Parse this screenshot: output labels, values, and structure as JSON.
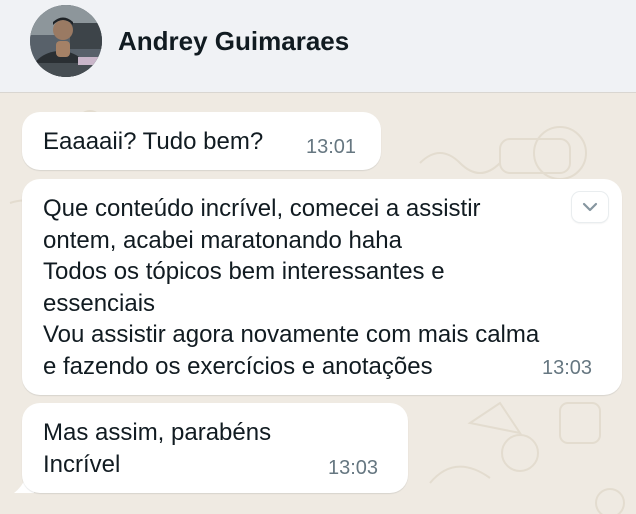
{
  "header": {
    "contact_name": "Andrey Guimaraes"
  },
  "messages": [
    {
      "text": "Eaaaaii? Tudo bem?",
      "time": "13:01"
    },
    {
      "text": "Que conteúdo incrível, comecei a assistir\nontem, acabei maratonando haha\nTodos os tópicos bem interessantes e\nessenciais\nVou assistir agora novamente com mais calma\ne fazendo os exercícios e anotações",
      "time": "13:03"
    },
    {
      "text": "Mas assim, parabéns\nIncrível",
      "time": "13:03"
    }
  ],
  "icons": {
    "message_menu": "chevron-down-icon"
  },
  "colors": {
    "header_bg": "#f0f2f5",
    "chat_bg": "#efeae2",
    "bubble_bg": "#ffffff",
    "text": "#111b21",
    "meta_text": "#667781"
  }
}
